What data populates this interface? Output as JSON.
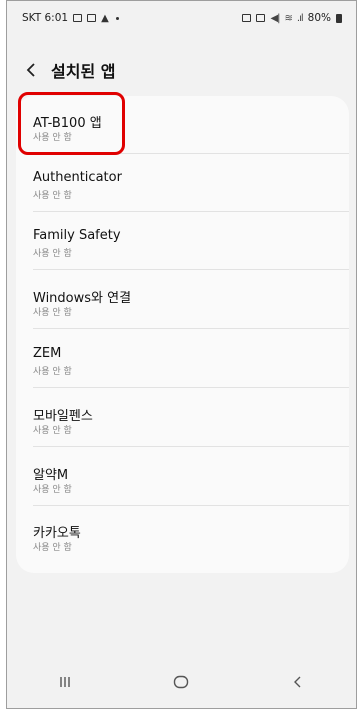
{
  "status_bar": {
    "carrier_time": "SKT 6:01",
    "battery": "80%"
  },
  "header": {
    "title": "설치된 앱"
  },
  "apps": [
    {
      "name": "AT-B100 앱",
      "status": "사용 안 함"
    },
    {
      "name": "Authenticator",
      "status": "사용 안 함"
    },
    {
      "name": "Family Safety",
      "status": "사용 안 함"
    },
    {
      "name": "Windows와 연결",
      "status": "사용 안 함"
    },
    {
      "name": "ZEM",
      "status": "사용 안 함"
    },
    {
      "name": "모바일펜스",
      "status": "사용 안 함"
    },
    {
      "name": "알약M",
      "status": "사용 안 함"
    },
    {
      "name": "카카오톡",
      "status": "사용 안 함"
    }
  ],
  "icons": {
    "back": "back-arrow-icon",
    "recents": "recents-icon",
    "home": "home-icon",
    "nav_back": "nav-back-icon"
  },
  "colors": {
    "highlight": "#e00000",
    "background": "#f2f2f2",
    "card": "#fafafa"
  }
}
